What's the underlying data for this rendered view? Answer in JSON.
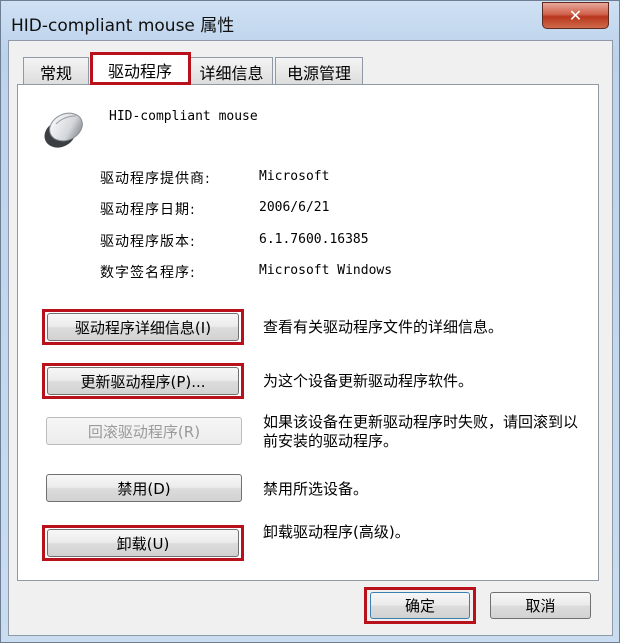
{
  "window": {
    "title": "HID-compliant mouse 属性",
    "close_glyph": "✕"
  },
  "tabs": [
    {
      "label": "常规",
      "active": false
    },
    {
      "label": "驱动程序",
      "active": true
    },
    {
      "label": "详细信息",
      "active": false
    },
    {
      "label": "电源管理",
      "active": false
    }
  ],
  "device": {
    "name": "HID-compliant mouse",
    "icon": "mouse-icon"
  },
  "info": [
    {
      "label": "驱动程序提供商:",
      "value": "Microsoft"
    },
    {
      "label": "驱动程序日期:",
      "value": "2006/6/21"
    },
    {
      "label": "驱动程序版本:",
      "value": "6.1.7600.16385"
    },
    {
      "label": "数字签名程序:",
      "value": "Microsoft Windows"
    }
  ],
  "actions": [
    {
      "button": "驱动程序详细信息(I)",
      "description": "查看有关驱动程序文件的详细信息。",
      "enabled": true
    },
    {
      "button": "更新驱动程序(P)...",
      "description": "为这个设备更新驱动程序软件。",
      "enabled": true
    },
    {
      "button": "回滚驱动程序(R)",
      "description": "如果该设备在更新驱动程序时失败，请回滚到以前安装的驱动程序。",
      "enabled": false
    },
    {
      "button": "禁用(D)",
      "description": "禁用所选设备。",
      "enabled": true
    },
    {
      "button": "卸载(U)",
      "description": "卸载驱动程序(高级)。",
      "enabled": true
    }
  ],
  "footer": {
    "ok": "确定",
    "cancel": "取消"
  },
  "colors": {
    "highlight": "#b8111b",
    "close_button": "#c9472b"
  }
}
